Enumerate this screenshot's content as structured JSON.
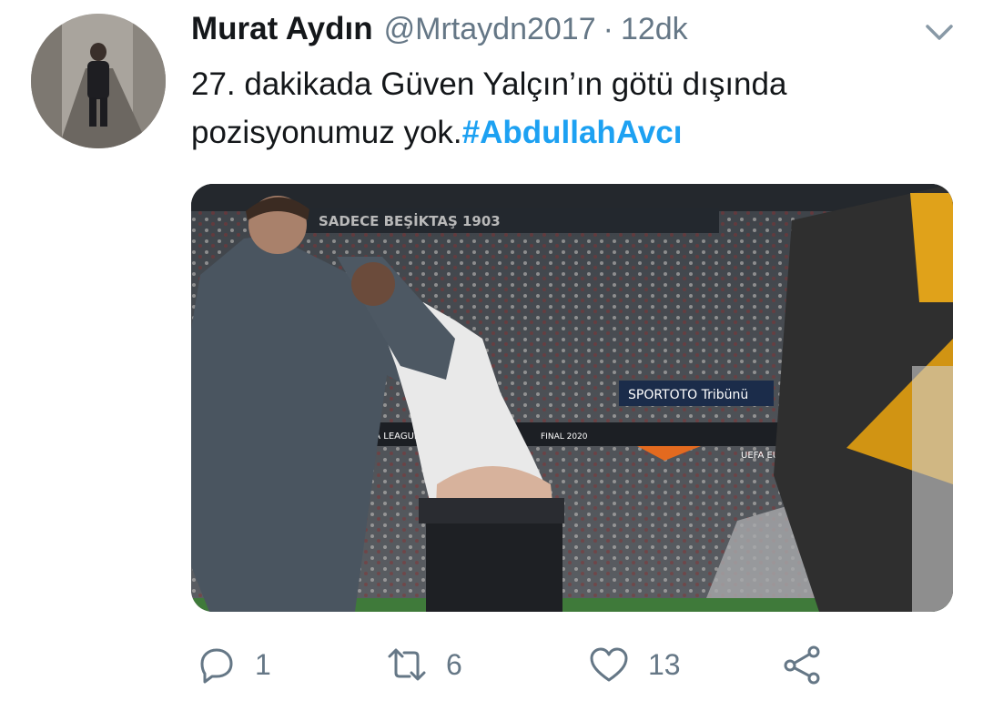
{
  "author": {
    "name": "Murat Aydın",
    "handle": "@Mrtaydn2017",
    "separator": "·",
    "time": "12dk"
  },
  "tweet": {
    "line1": "27. dakikada Güven Yalçın’ın götü dışında",
    "line2_prefix": "pozisyonumuz yok.",
    "hashtag": "#AbdullahAvcı"
  },
  "media": {
    "banner_text": "SADECE   BEŞİKTAŞ   1903",
    "sponsor_sign": "SPORTOTO Tribünü",
    "board_left": "OPA LEAGUE",
    "board_final": "FINAL 2020",
    "board_right": "UEFA EUR"
  },
  "actions": {
    "replies": "1",
    "retweets": "6",
    "likes": "13"
  },
  "icons": {
    "caret": "chevron-down-icon",
    "reply": "reply-icon",
    "retweet": "retweet-icon",
    "like": "heart-icon",
    "share": "share-icon"
  },
  "colors": {
    "text": "#14171a",
    "secondary": "#657786",
    "hashtag": "#1da1f2",
    "icon": "#657786"
  }
}
